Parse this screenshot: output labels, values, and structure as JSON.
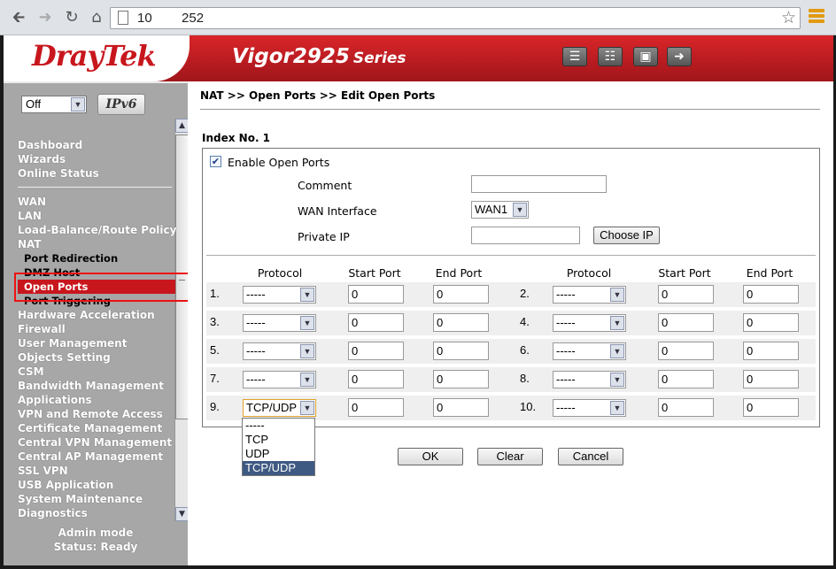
{
  "browser": {
    "url": "10        252"
  },
  "header": {
    "logo": "DrayTek",
    "model": "Vigor2925",
    "series": "Series"
  },
  "sidebar": {
    "lang_value": "Off",
    "ipv6_label": "IPv6",
    "group1": [
      "Dashboard",
      "Wizards",
      "Online Status"
    ],
    "group2": [
      "WAN",
      "LAN",
      "Load-Balance/Route Policy",
      "NAT"
    ],
    "nat_sub": [
      "Port Redirection",
      "DMZ Host",
      "Open Ports",
      "Port Triggering"
    ],
    "group3": [
      "Hardware Acceleration",
      "Firewall",
      "User Management",
      "Objects Setting",
      "CSM",
      "Bandwidth Management",
      "Applications",
      "VPN and Remote Access",
      "Certificate Management",
      "Central VPN Management",
      "Central AP Management",
      "SSL VPN",
      "USB Application",
      "System Maintenance",
      "Diagnostics"
    ],
    "status": [
      "Admin mode",
      "Status: Ready"
    ]
  },
  "main": {
    "breadcrumb": "NAT >> Open Ports >> Edit Open Ports",
    "index_label": "Index No. 1",
    "enable_label": "Enable Open Ports",
    "enable_checked": true,
    "comment_label": "Comment",
    "comment_value": "",
    "wan_label": "WAN Interface",
    "wan_value": "WAN1",
    "ip_label": "Private IP",
    "ip_value": "",
    "choose_ip": "Choose IP",
    "col_protocol": "Protocol",
    "col_start": "Start Port",
    "col_end": "End Port",
    "rows": [
      {
        "num": "1.",
        "protocol": "-----",
        "start": "0",
        "end": "0"
      },
      {
        "num": "2.",
        "protocol": "-----",
        "start": "0",
        "end": "0"
      },
      {
        "num": "3.",
        "protocol": "-----",
        "start": "0",
        "end": "0"
      },
      {
        "num": "4.",
        "protocol": "-----",
        "start": "0",
        "end": "0"
      },
      {
        "num": "5.",
        "protocol": "-----",
        "start": "0",
        "end": "0"
      },
      {
        "num": "6.",
        "protocol": "-----",
        "start": "0",
        "end": "0"
      },
      {
        "num": "7.",
        "protocol": "-----",
        "start": "0",
        "end": "0"
      },
      {
        "num": "8.",
        "protocol": "-----",
        "start": "0",
        "end": "0"
      },
      {
        "num": "9.",
        "protocol": "TCP/UDP",
        "start": "0",
        "end": "0"
      },
      {
        "num": "10.",
        "protocol": "-----",
        "start": "0",
        "end": "0"
      }
    ],
    "dropdown_options": [
      "-----",
      "TCP",
      "UDP",
      "TCP/UDP"
    ],
    "ok": "OK",
    "clear": "Clear",
    "cancel": "Cancel"
  },
  "colors": {
    "brand_red": "#c8161d",
    "sidebar_gray": "#a7a7a7",
    "selected_option": "#3e5a82",
    "highlight_outline": "#ee1111"
  },
  "icons": [
    "back-arrow-icon",
    "forward-arrow-icon",
    "reload-icon",
    "home-icon",
    "page-icon",
    "star-icon",
    "menu-icon",
    "quick-start-icon",
    "settings-icon",
    "save-icon",
    "logout-icon"
  ]
}
